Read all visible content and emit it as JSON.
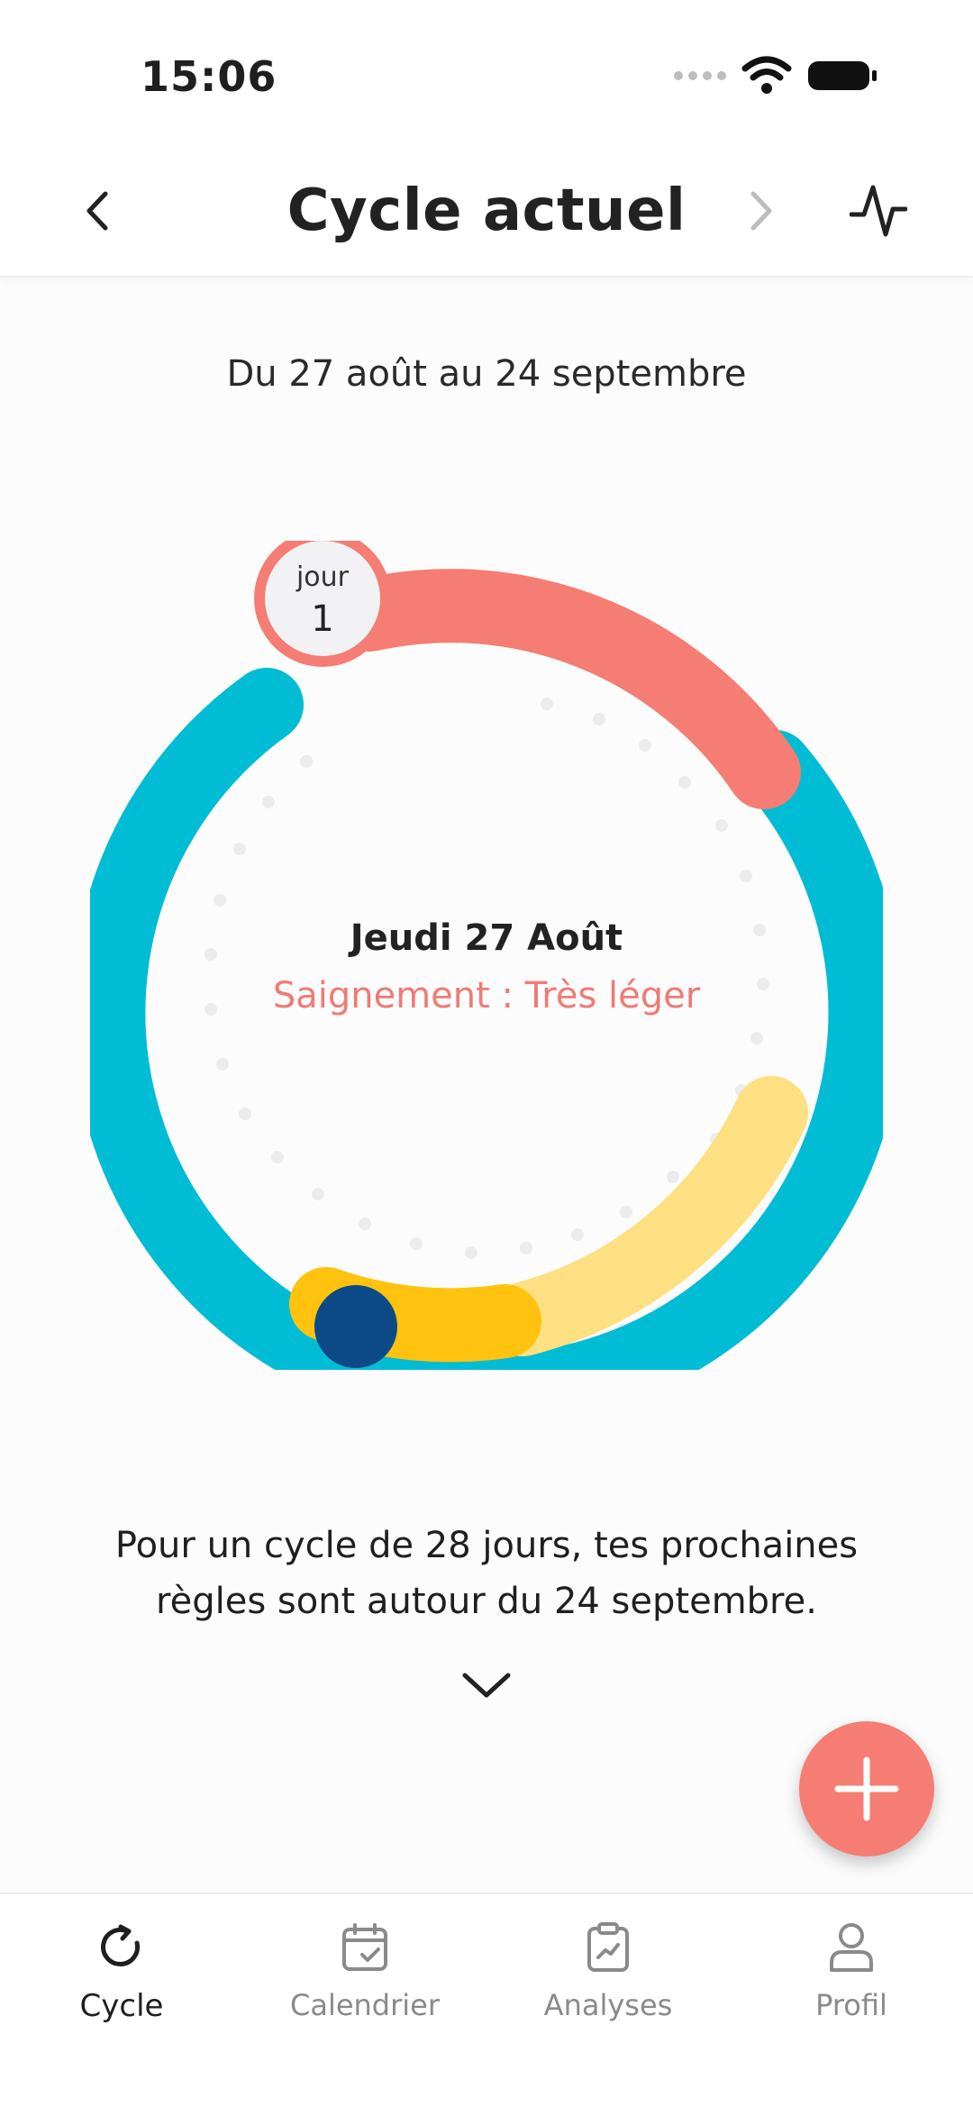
{
  "status_bar": {
    "time": "15:06"
  },
  "header": {
    "title": "Cycle actuel"
  },
  "cycle": {
    "date_range": "Du 27 août au 24 septembre",
    "day_label": "jour",
    "day_number": "1",
    "selected_date": "Jeudi 27 Août",
    "bleeding": "Saignement : Très léger",
    "prediction_line1": "Pour un cycle de 28 jours, tes prochaines",
    "prediction_line2": "règles sont autour du 24 septembre.",
    "cycle_length_days": 28,
    "colors": {
      "period": "#f57d73",
      "neutral": "#00bcd4",
      "fertile": "#fde082",
      "fertile_peak": "#ffc20e",
      "ovulation": "#0b4a86"
    }
  },
  "bottom_nav": {
    "items": [
      {
        "label": "Cycle",
        "icon": "cycle-icon"
      },
      {
        "label": "Calendrier",
        "icon": "calendar-icon"
      },
      {
        "label": "Analyses",
        "icon": "analytics-icon"
      },
      {
        "label": "Profil",
        "icon": "profile-icon"
      }
    ]
  }
}
